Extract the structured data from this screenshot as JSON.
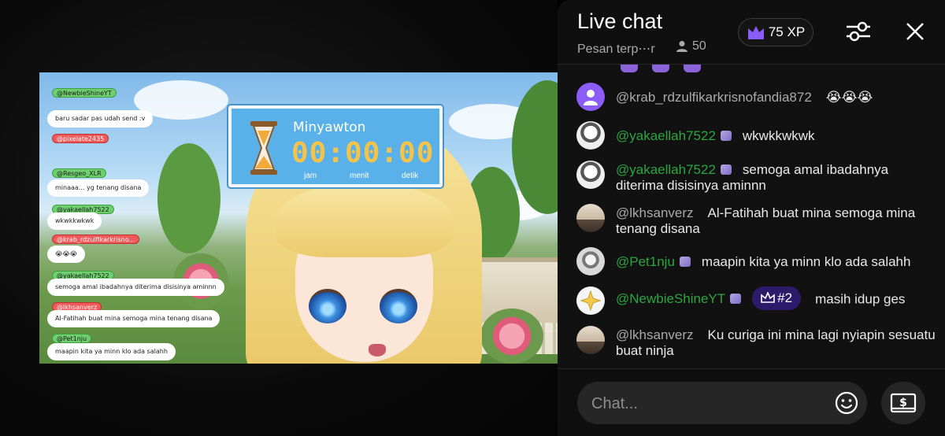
{
  "stream": {
    "timer": {
      "name": "Minyawton",
      "digits": "00:00:00",
      "labels": [
        "jam",
        "menit",
        "detik"
      ]
    },
    "overlay_chat": [
      {
        "name": "@NewbieShineYT",
        "color": "green",
        "text": "baru sadar pas udah send :v"
      },
      {
        "name": "@pixelate2435",
        "color": "red",
        "text": ""
      },
      {
        "name": "@Resgeo_XLR",
        "color": "green",
        "text": "minaaa... yg tenang disana"
      },
      {
        "name": "@yakaellah7522",
        "color": "green",
        "text": "wkwkkwkwk"
      },
      {
        "name": "@krab_rdzulfikarkrisno...",
        "color": "red",
        "text": "😭😭😭"
      },
      {
        "name": "@yakaellah7522",
        "color": "green",
        "text": "semoga amal ibadahnya diterima disisinya aminnn"
      },
      {
        "name": "@lkhsanverz",
        "color": "red",
        "text": "Al-Fatihah buat mina semoga mina tenang disana"
      },
      {
        "name": "@Pet1nju",
        "color": "green",
        "text": "maapin kita ya minn klo ada salahh"
      }
    ]
  },
  "header": {
    "title": "Live chat",
    "subtitle": "Pesan terp⋯r",
    "viewer_count": "50",
    "xp_label": "75 XP"
  },
  "messages": [
    {
      "author": "@krab_rdzulfikarkrisnofandia872",
      "member": false,
      "text": "😭😭😭",
      "avatar_color": "#8b5cf6"
    },
    {
      "author": "@yakaellah7522",
      "member": true,
      "text": "wkwkkwkwk",
      "avatar_color": "#e8e8e8"
    },
    {
      "author": "@yakaellah7522",
      "member": true,
      "text": "semoga amal ibadahnya diterima disisinya aminnn",
      "avatar_color": "#e8e8e8"
    },
    {
      "author": "@lkhsanverz",
      "member": false,
      "text": "Al-Fatihah buat mina semoga mina tenang disana",
      "avatar_color": "#c9b8a3"
    },
    {
      "author": "@Pet1nju",
      "member": true,
      "text": "maapin kita ya minn klo ada salahh",
      "avatar_color": "#d9d9d9"
    },
    {
      "author": "@NewbieShineYT",
      "member": true,
      "rank": "#2",
      "text": "masih idup ges",
      "avatar_color": "#f5f5f5"
    },
    {
      "author": "@lkhsanverz",
      "member": false,
      "text": "Ku curiga ini mina lagi nyiapin sesuatu buat ninja",
      "avatar_color": "#c9b8a3"
    }
  ],
  "footer": {
    "placeholder": "Chat..."
  },
  "colors": {
    "member_name": "#2ba640",
    "panel_bg": "#111111",
    "xp_crown": "#8b5cf6",
    "rank_bg": "#2c1a6b"
  },
  "icons": [
    "person-icon",
    "crown-icon",
    "sliders-icon",
    "close-icon",
    "emoji-icon",
    "super-chat-icon",
    "hourglass-icon"
  ]
}
